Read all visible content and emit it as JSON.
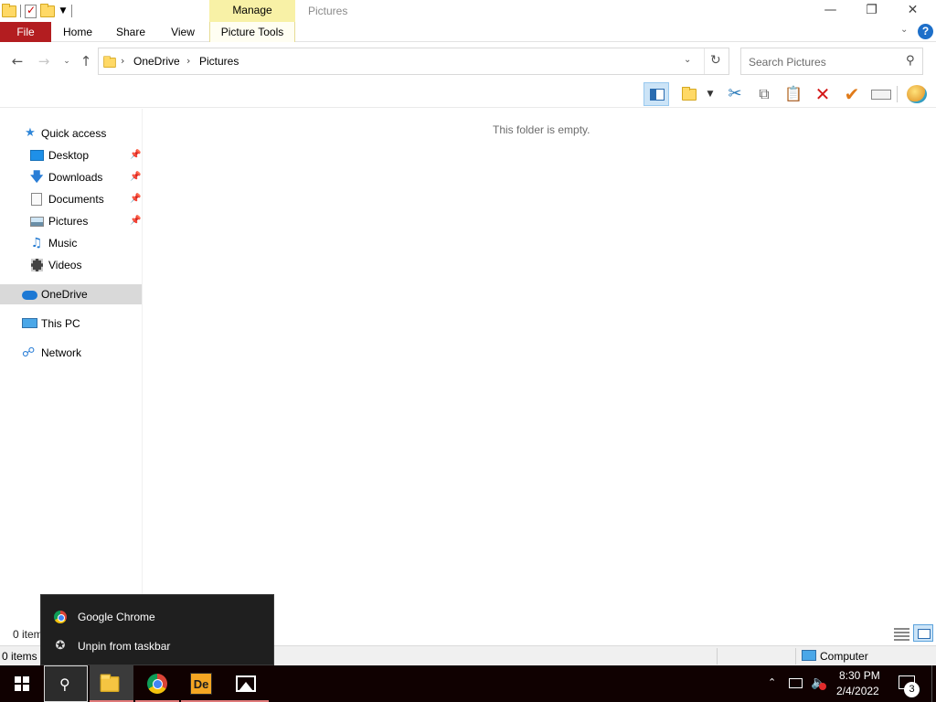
{
  "titlebar": {
    "title": "Pictures",
    "manage_tab": "Manage",
    "minimize_glyph": "—",
    "maximize_glyph": "❐",
    "close_glyph": "✕"
  },
  "ribbon": {
    "tabs": [
      {
        "label": "File"
      },
      {
        "label": "Home"
      },
      {
        "label": "Share"
      },
      {
        "label": "View"
      },
      {
        "label": "Picture Tools"
      }
    ],
    "help_label": "?",
    "accent_color": "#b31d20",
    "contextual_color": "#f8f1a6"
  },
  "navigation": {
    "breadcrumb": [
      "OneDrive",
      "Pictures"
    ],
    "search_placeholder": "Search Pictures"
  },
  "toolbar": {
    "icons": [
      "preview-pane-icon",
      "new-folder-icon",
      "cut-icon",
      "copy-icon",
      "paste-icon",
      "delete-icon",
      "properties-check-icon",
      "rename-icon",
      "shell-icon"
    ]
  },
  "nav_pane": {
    "quick_access": "Quick access",
    "items": [
      {
        "label": "Desktop",
        "icon": "desktop-icon",
        "pinned": true
      },
      {
        "label": "Downloads",
        "icon": "downloads-icon",
        "pinned": true
      },
      {
        "label": "Documents",
        "icon": "documents-icon",
        "pinned": true
      },
      {
        "label": "Pictures",
        "icon": "pictures-icon",
        "pinned": true
      },
      {
        "label": "Music",
        "icon": "music-icon",
        "pinned": false
      },
      {
        "label": "Videos",
        "icon": "videos-icon",
        "pinned": false
      }
    ],
    "onedrive": "OneDrive",
    "this_pc": "This PC",
    "network": "Network"
  },
  "content": {
    "empty_message": "This folder is empty.",
    "item_count": "0 items"
  },
  "statusbar": {
    "item_count": "0 items",
    "location": "Computer"
  },
  "jumplist": {
    "items": [
      {
        "label": "Google Chrome",
        "icon": "chrome-icon"
      },
      {
        "label": "Unpin from taskbar",
        "icon": "unpin-icon"
      }
    ]
  },
  "taskbar": {
    "apps": [
      "start-button",
      "search-button",
      "file-explorer",
      "google-chrome",
      "de-app",
      "photos-app"
    ],
    "de_label": "De",
    "clock_time": "8:30 PM",
    "clock_date": "2/4/2022",
    "notification_count": "3"
  }
}
